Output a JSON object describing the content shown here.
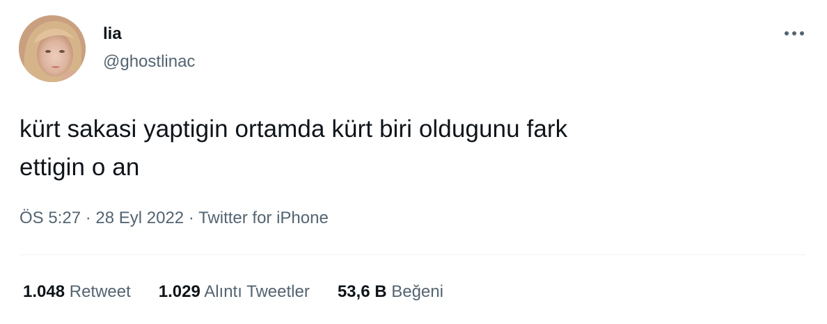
{
  "user": {
    "name": "lia",
    "handle": "@ghostlinac"
  },
  "tweet": {
    "text_line1": "kürt sakasi yaptigin ortamda kürt biri oldugunu fark",
    "text_line2": "ettigin o an"
  },
  "meta": {
    "time": "ÖS 5:27",
    "sep1": " · ",
    "date": "28 Eyl 2022",
    "sep2": " · ",
    "source": "Twitter for iPhone"
  },
  "stats": [
    {
      "count": "1.048",
      "label": "Retweet"
    },
    {
      "count": "1.029",
      "label": "Alıntı Tweetler"
    },
    {
      "count": "53,6 B",
      "label": "Beğeni"
    }
  ],
  "icons": {
    "more": "more-horizontal-icon"
  },
  "colors": {
    "text": "#0f1419",
    "secondary": "#536471",
    "divider": "#eff3f4"
  }
}
